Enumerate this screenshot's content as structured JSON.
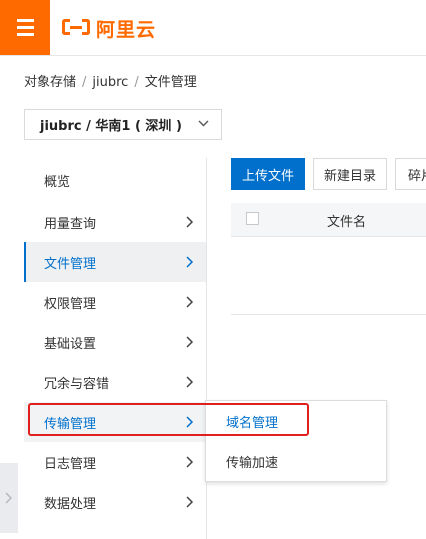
{
  "brand": {
    "logo_text": "阿里云",
    "color": "#ff6a00"
  },
  "header": {
    "menu_icon": "hamburger-icon"
  },
  "breadcrumb": {
    "items": [
      "对象存储",
      "jiubrc",
      "文件管理"
    ],
    "separator": "/"
  },
  "bucket_select": {
    "value": "jiubrc / 华南1 ( 深圳 )"
  },
  "sidebar": {
    "items": [
      {
        "label": "概览"
      },
      {
        "label": "用量查询"
      },
      {
        "label": "文件管理"
      },
      {
        "label": "权限管理"
      },
      {
        "label": "基础设置"
      },
      {
        "label": "冗余与容错"
      },
      {
        "label": "传输管理"
      },
      {
        "label": "日志管理"
      },
      {
        "label": "数据处理"
      }
    ],
    "active_index": 2,
    "hover_index": 6,
    "accent": "#0070cc"
  },
  "submenu": {
    "items": [
      {
        "label": "域名管理"
      },
      {
        "label": "传输加速"
      }
    ]
  },
  "toolbar": {
    "upload_label": "上传文件",
    "new_dir_label": "新建目录",
    "fragment_label": "碎片"
  },
  "table": {
    "columns": [
      "文件名"
    ]
  },
  "highlight_color": "#e0201c"
}
